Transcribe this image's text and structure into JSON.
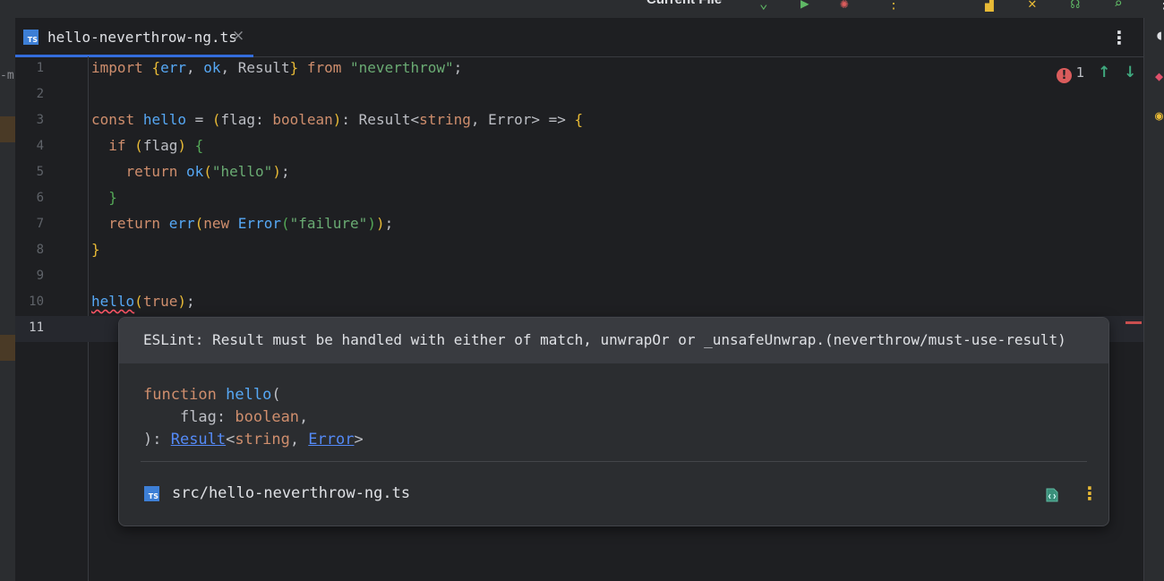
{
  "toolbar": {
    "run_config_label": "Current File"
  },
  "sidebar_left": {
    "fragment": "-m"
  },
  "tab": {
    "badge": "TS",
    "title": "hello-neverthrow-ng.ts",
    "close_glyph": "×",
    "more_glyph": "⋮"
  },
  "inspections": {
    "error_glyph": "!",
    "error_count": "1",
    "prev_glyph": "↑",
    "next_glyph": "↓"
  },
  "line_numbers": [
    "1",
    "2",
    "3",
    "4",
    "5",
    "6",
    "7",
    "8",
    "9",
    "10",
    "11"
  ],
  "current_line": "11",
  "popup": {
    "message": "ESLint: Result must be handled with either of match, unwrapOr or _unsafeUnwrap.(neverthrow/must-use-result)",
    "signature": {
      "keyword": "function",
      "name": "hello",
      "open": "(",
      "param_name": "flag",
      "param_colon": ": ",
      "param_type": "boolean",
      "param_comma": ",",
      "close": "): ",
      "return_type": "Result",
      "generic_open": "<",
      "generic_arg1": "string",
      "generic_sep": ", ",
      "generic_arg2": "Error",
      "generic_close": ">"
    },
    "file_badge": "TS",
    "file_path": "src/hello-neverthrow-ng.ts",
    "more_glyph": "⋮"
  },
  "colors": {
    "editor_bg": "#1e1f22",
    "popup_bg": "#2b2d30",
    "error_red": "#db5c5c",
    "keyword": "#cf8e6d",
    "string": "#6aab73",
    "function": "#56a8f5",
    "link": "#548af7"
  }
}
